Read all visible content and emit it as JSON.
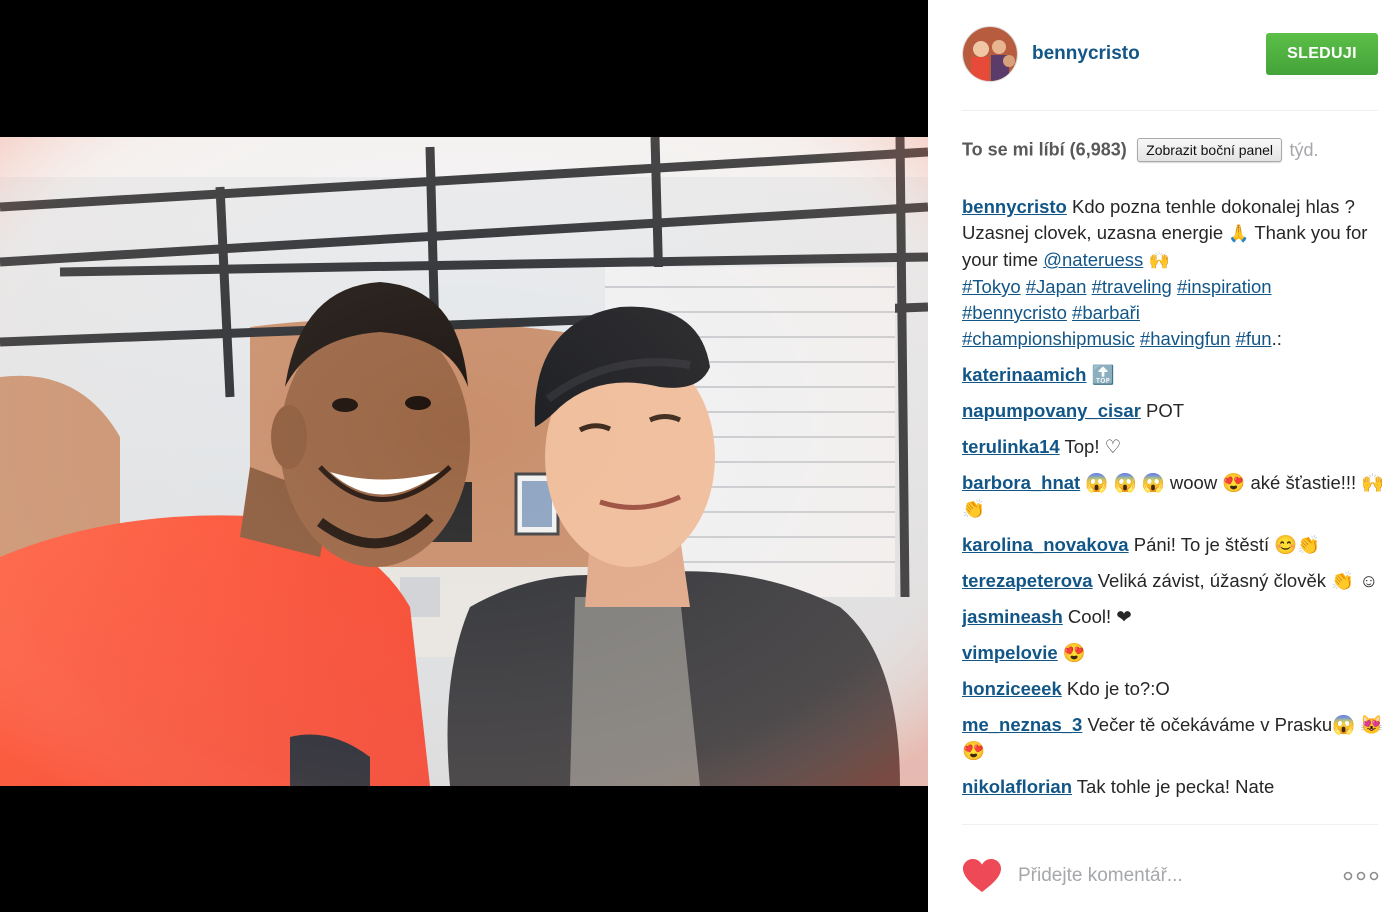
{
  "post": {
    "username": "bennycristo",
    "follow_label": "SLEDUJI",
    "likes_label": "To se mi líbí (6,983)",
    "side_panel_button": "Zobrazit boční panel",
    "time_label": "týd.",
    "caption": {
      "user": "bennycristo",
      "line1": " Kdo pozna tenhle dokonalej hlas ? Uzasnej clovek, uzasna energie ",
      "line1_emoji": "🙏",
      "line2": " Thank you for your time ",
      "mention": "@nateruess",
      "line2_emoji": " 🙌",
      "hashtags": [
        "#Tokyo",
        "#Japan",
        "#traveling",
        "#inspiration",
        "#bennycristo",
        "#barbaři",
        "#championshipmusic",
        "#havingfun",
        "#fun"
      ],
      "tail": ".:"
    },
    "comments": [
      {
        "user": "katerinaamich",
        "text": " 🔝"
      },
      {
        "user": "napumpovany_cisar",
        "text": " POT"
      },
      {
        "user": "terulinka14",
        "text": " Top! ♡"
      },
      {
        "user": "barbora_hnat",
        "text": " 😱 😱 😱  woow 😍  aké šťastie!!! 🙌👏"
      },
      {
        "user": "karolina_novakova",
        "text": " Páni! To je štěstí 😊👏"
      },
      {
        "user": "terezapeterova",
        "text": " Veliká závist, úžasný člověk 👏 ☺"
      },
      {
        "user": "jasmineash",
        "text": " Cool! ❤"
      },
      {
        "user": "vimpelovie",
        "text": " 😍"
      },
      {
        "user": "honziceeek",
        "text": " Kdo je to?:O"
      },
      {
        "user": "me_neznas_3",
        "text": " Večer tě očekáváme v Prasku😱 😻 😍"
      },
      {
        "user": "nikolaflorian",
        "text": " Tak tohle je pecka! Nate"
      }
    ],
    "comment_placeholder": "Přidejte komentář...",
    "icons": {
      "like": "heart-icon",
      "more": "more-dots-icon"
    },
    "colors": {
      "link": "#125688",
      "follow": "#44a33a",
      "heart": "#ed4956"
    }
  }
}
